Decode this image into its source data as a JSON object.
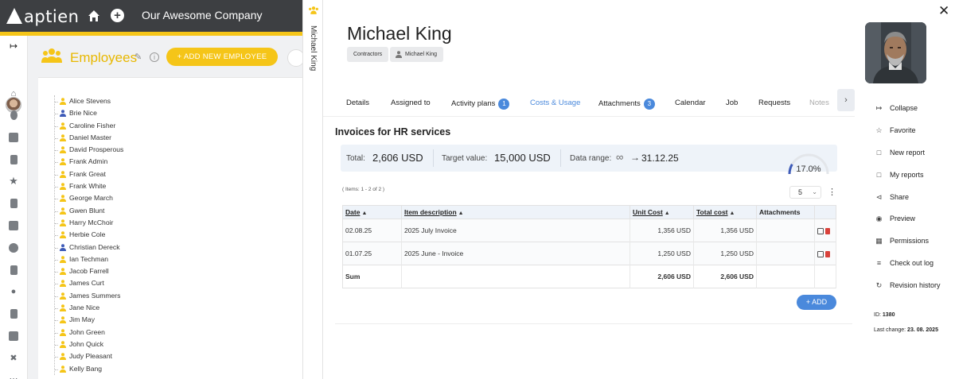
{
  "app": {
    "logo": "aptien",
    "company": "Our Awesome Company"
  },
  "employees": {
    "title": "Employees",
    "add_button": "+ ADD NEW EMPLOYEE",
    "list": [
      {
        "name": "Alice Stevens",
        "color": "#f5c518"
      },
      {
        "name": "Brie Nice",
        "color": "#3e5bb8"
      },
      {
        "name": "Caroline Fisher",
        "color": "#f5c518"
      },
      {
        "name": "Daniel Master",
        "color": "#f5c518"
      },
      {
        "name": "David Prosperous",
        "color": "#f5c518"
      },
      {
        "name": "Frank Admin",
        "color": "#f5c518"
      },
      {
        "name": "Frank Great",
        "color": "#f5c518"
      },
      {
        "name": "Frank White",
        "color": "#f5c518"
      },
      {
        "name": "George March",
        "color": "#f5c518"
      },
      {
        "name": "Gwen Blunt",
        "color": "#f5c518"
      },
      {
        "name": "Harry McChoir",
        "color": "#f5c518"
      },
      {
        "name": "Herbie Cole",
        "color": "#f5c518"
      },
      {
        "name": "Christian Dereck",
        "color": "#3e5bb8"
      },
      {
        "name": "Ian Techman",
        "color": "#f5c518"
      },
      {
        "name": "Jacob Farrell",
        "color": "#f5c518"
      },
      {
        "name": "James Curt",
        "color": "#f5c518"
      },
      {
        "name": "James Summers",
        "color": "#f5c518"
      },
      {
        "name": "Jane Nice",
        "color": "#f5c518"
      },
      {
        "name": "Jim May",
        "color": "#f5c518"
      },
      {
        "name": "John Green",
        "color": "#f5c518"
      },
      {
        "name": "John Quick",
        "color": "#f5c518"
      },
      {
        "name": "Judy Pleasant",
        "color": "#f5c518"
      },
      {
        "name": "Kelly Bang",
        "color": "#f5c518"
      }
    ]
  },
  "strip": {
    "label": "Michael King"
  },
  "detail": {
    "name": "Michael King",
    "chips": {
      "contractors": "Contractors",
      "person": "Michael King"
    },
    "tabs": {
      "details": "Details",
      "assigned": "Assigned to",
      "activity": "Activity plans",
      "activity_badge": "1",
      "costs": "Costs & Usage",
      "attachments": "Attachments",
      "attachments_badge": "3",
      "calendar": "Calendar",
      "job": "Job",
      "requests": "Requests",
      "notes": "Notes"
    },
    "section_title": "Invoices for HR services",
    "stats": {
      "total_label": "Total:",
      "total_value": "2,606 USD",
      "target_label": "Target value:",
      "target_value": "15,000 USD",
      "range_label": "Data range:",
      "range_value": "31.12.25",
      "gauge_value": "17.0%",
      "gauge_fraction": 0.17
    },
    "items_count": "( Items: 1 - 2 of 2 )",
    "page_size": "5",
    "table": {
      "headers": {
        "date": "Date",
        "desc": "Item description",
        "unit": "Unit Cost",
        "total": "Total cost",
        "attachments": "Attachments"
      },
      "rows": [
        {
          "date": "02.08.25",
          "desc": "2025 July Invoice",
          "unit": "1,356 USD",
          "total": "1,356 USD"
        },
        {
          "date": "01.07.25",
          "desc": "2025 June - Invoice",
          "unit": "1,250 USD",
          "total": "1,250 USD"
        }
      ],
      "sum": {
        "label": "Sum",
        "unit": "2,606 USD",
        "total": "2,606 USD"
      }
    },
    "add_button": "+ ADD",
    "actions": {
      "collapse": "Collapse",
      "favorite": "Favorite",
      "new_report": "New report",
      "my_reports": "My reports",
      "share": "Share",
      "preview": "Preview",
      "permissions": "Permissions",
      "checkout": "Check out log",
      "revision": "Revision history"
    },
    "meta": {
      "id_label": "ID:",
      "id_value": "1380",
      "last_change_label": "Last change:",
      "last_change_value": "23. 08. 2025"
    }
  },
  "colors": {
    "accent_yellow": "#f5c518",
    "accent_blue": "#4a89dc",
    "topbar": "#3d3f42",
    "delete_red": "#d9413a"
  }
}
